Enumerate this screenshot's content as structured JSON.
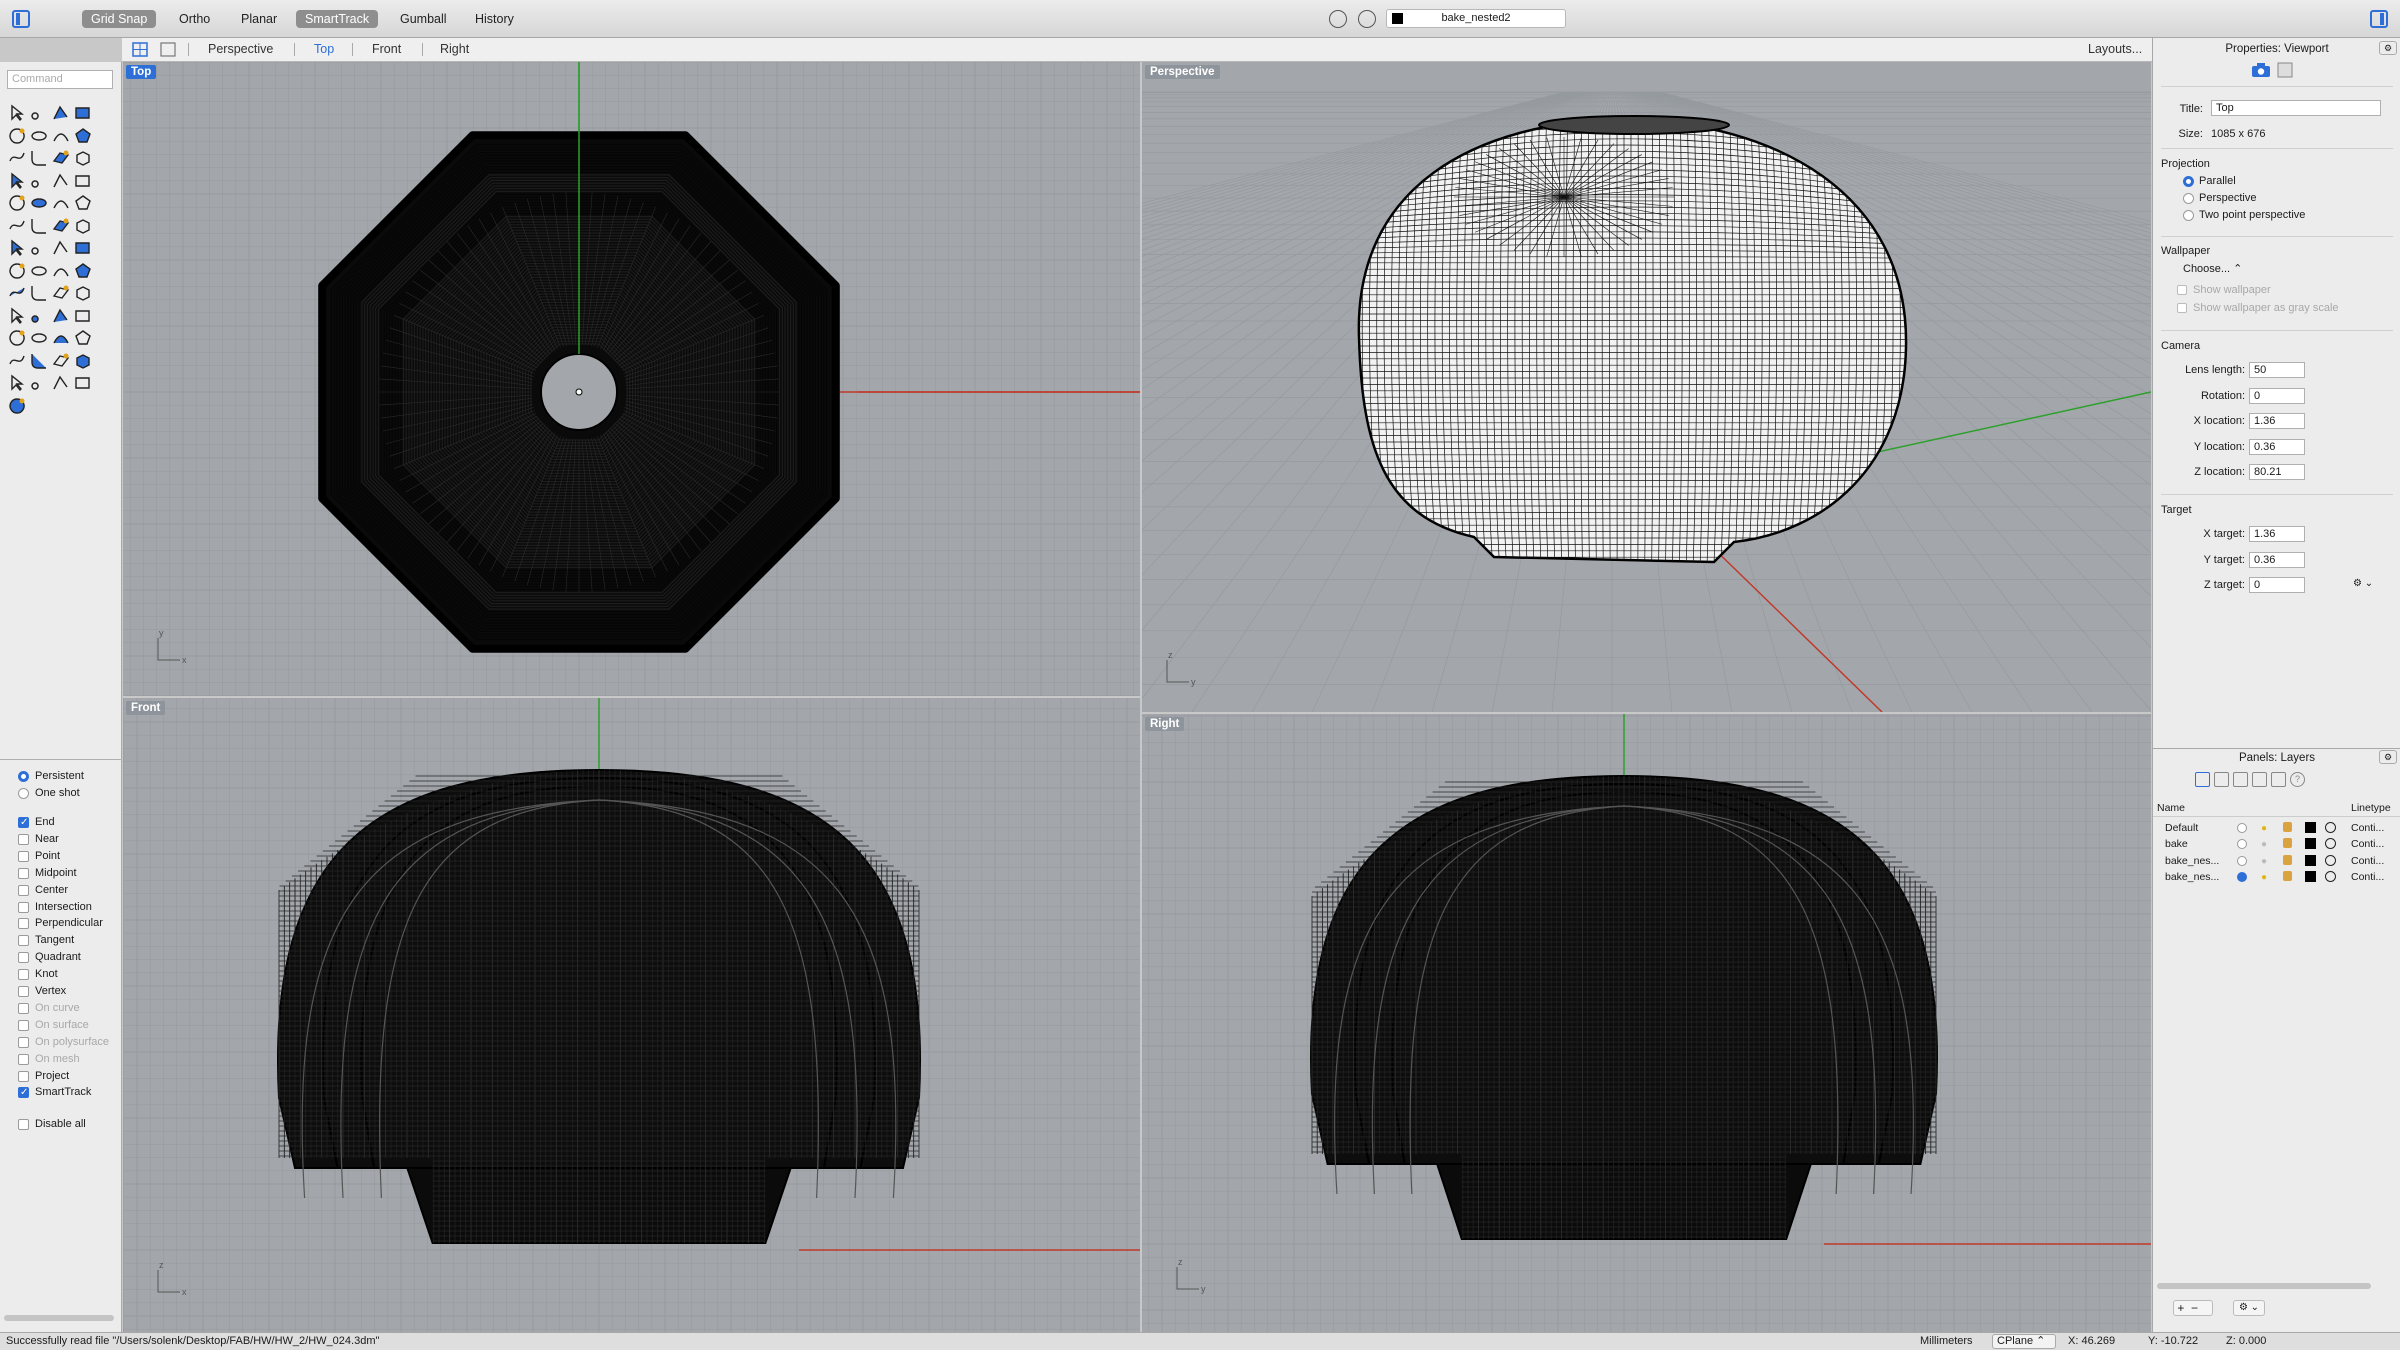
{
  "toolbar": {
    "buttons": [
      {
        "label": "Grid Snap",
        "on": true
      },
      {
        "label": "Ortho",
        "on": false
      },
      {
        "label": "Planar",
        "on": false
      },
      {
        "label": "SmartTrack",
        "on": true
      },
      {
        "label": "Gumball",
        "on": false
      },
      {
        "label": "History",
        "on": false
      }
    ],
    "document_layer": "bake_nested2"
  },
  "tabs": {
    "items": [
      "Perspective",
      "Top",
      "Front",
      "Right"
    ],
    "active": "Top",
    "layouts": "Layouts..."
  },
  "command": {
    "placeholder": "Command"
  },
  "osnap": {
    "mode": [
      {
        "label": "Persistent",
        "on": true
      },
      {
        "label": "One shot",
        "on": false
      }
    ],
    "items": [
      {
        "label": "End",
        "on": true,
        "disabled": false
      },
      {
        "label": "Near",
        "on": false,
        "disabled": false
      },
      {
        "label": "Point",
        "on": false,
        "disabled": false
      },
      {
        "label": "Midpoint",
        "on": false,
        "disabled": false
      },
      {
        "label": "Center",
        "on": false,
        "disabled": false
      },
      {
        "label": "Intersection",
        "on": false,
        "disabled": false
      },
      {
        "label": "Perpendicular",
        "on": false,
        "disabled": false
      },
      {
        "label": "Tangent",
        "on": false,
        "disabled": false
      },
      {
        "label": "Quadrant",
        "on": false,
        "disabled": false
      },
      {
        "label": "Knot",
        "on": false,
        "disabled": false
      },
      {
        "label": "Vertex",
        "on": false,
        "disabled": false
      },
      {
        "label": "On curve",
        "on": false,
        "disabled": true
      },
      {
        "label": "On surface",
        "on": false,
        "disabled": true
      },
      {
        "label": "On polysurface",
        "on": false,
        "disabled": true
      },
      {
        "label": "On mesh",
        "on": false,
        "disabled": true
      },
      {
        "label": "Project",
        "on": false,
        "disabled": false
      },
      {
        "label": "SmartTrack",
        "on": true,
        "disabled": false
      }
    ],
    "disable_all": "Disable all"
  },
  "viewports": {
    "top": "Top",
    "perspective": "Perspective",
    "front": "Front",
    "right": "Right"
  },
  "properties": {
    "header": "Properties: Viewport",
    "title_label": "Title:",
    "title_value": "Top",
    "size_label": "Size:",
    "size_value": "1085 x 676",
    "projection": {
      "label": "Projection",
      "options": [
        "Parallel",
        "Perspective",
        "Two point perspective"
      ],
      "selected": "Parallel"
    },
    "wallpaper": {
      "label": "Wallpaper",
      "choose": "Choose...",
      "show": "Show wallpaper",
      "gray": "Show wallpaper as gray scale"
    },
    "camera": {
      "label": "Camera",
      "fields": [
        {
          "label": "Lens length:",
          "value": "50"
        },
        {
          "label": "Rotation:",
          "value": "0"
        },
        {
          "label": "X location:",
          "value": "1.36"
        },
        {
          "label": "Y location:",
          "value": "0.36"
        },
        {
          "label": "Z location:",
          "value": "80.21"
        }
      ]
    },
    "target": {
      "label": "Target",
      "fields": [
        {
          "label": "X target:",
          "value": "1.36"
        },
        {
          "label": "Y target:",
          "value": "0.36"
        },
        {
          "label": "Z target:",
          "value": "0"
        }
      ]
    }
  },
  "layers": {
    "header": "Panels: Layers",
    "col_name": "Name",
    "col_linetype": "Linetype",
    "rows": [
      {
        "name": "Default",
        "linetype": "Conti...",
        "current": false
      },
      {
        "name": "bake",
        "linetype": "Conti...",
        "current": false
      },
      {
        "name": "bake_nes...",
        "linetype": "Conti...",
        "current": false
      },
      {
        "name": "bake_nes...",
        "linetype": "Conti...",
        "current": true
      }
    ]
  },
  "status": {
    "message": "Successfully read file \"/Users/solenk/Desktop/FAB/HW/HW_2/HW_024.3dm\"",
    "units": "Millimeters",
    "cplane": "CPlane",
    "x": "X: 46.269",
    "y": "Y: -10.722",
    "z": "Z: 0.000"
  },
  "colors": {
    "accent": "#2d6fd6",
    "viewport_bg": "#a3a7ab",
    "x_axis": "#c0392b",
    "y_axis": "#2ca02c"
  }
}
